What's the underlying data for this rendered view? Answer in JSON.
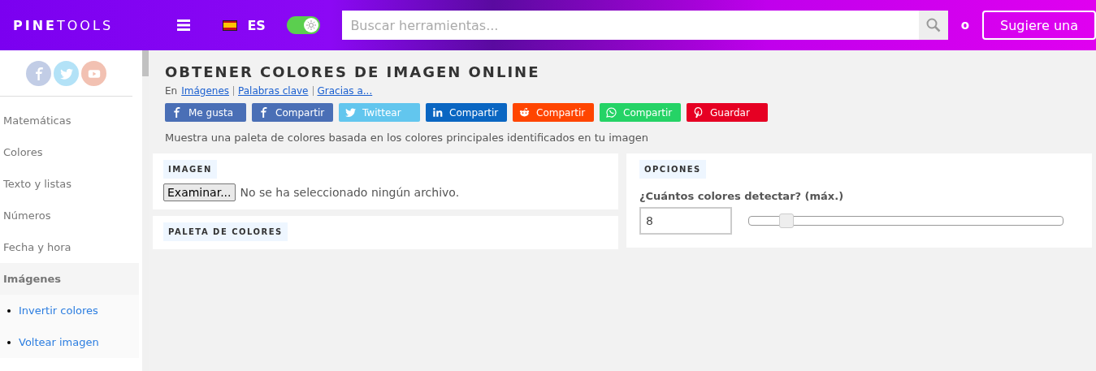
{
  "header": {
    "logo_bold": "PINE",
    "logo_light": "TOOLS",
    "language": "ES",
    "dark_mode_toggle": {
      "on": true
    },
    "search": {
      "placeholder": "Buscar herramientas..."
    },
    "extra": "o",
    "suggest_button": "Sugiere una"
  },
  "sidebar": {
    "social": [
      {
        "kind": "facebook"
      },
      {
        "kind": "twitter"
      },
      {
        "kind": "youtube"
      }
    ],
    "items": [
      {
        "label": "Matemáticas",
        "selected": false
      },
      {
        "label": "Colores",
        "selected": false
      },
      {
        "label": "Texto y listas",
        "selected": false
      },
      {
        "label": "Números",
        "selected": false
      },
      {
        "label": "Fecha y hora",
        "selected": false
      },
      {
        "label": "Imágenes",
        "selected": true,
        "children": [
          {
            "label": "Invertir colores"
          },
          {
            "label": "Voltear imagen"
          }
        ]
      }
    ]
  },
  "page": {
    "title": "OBTENER COLORES DE IMAGEN ONLINE",
    "breadcrumb_prefix": "En",
    "links": [
      "Imágenes",
      "Palabras clave",
      "Gracias a..."
    ],
    "share_buttons": [
      {
        "kind": "facebook",
        "label": "Me gusta"
      },
      {
        "kind": "facebook",
        "label": "Compartir"
      },
      {
        "kind": "twitter",
        "label": "Twittear"
      },
      {
        "kind": "linkedin",
        "label": "Compartir"
      },
      {
        "kind": "reddit",
        "label": "Compartir"
      },
      {
        "kind": "whatsapp",
        "label": "Compartir"
      },
      {
        "kind": "pinterest",
        "label": "Guardar"
      }
    ],
    "description": "Muestra una paleta de colores basada en los colores principales identificados en tu imagen",
    "image_panel": {
      "heading": "IMAGEN",
      "file_button": "Examinar...",
      "file_status": "No se ha seleccionado ningún archivo."
    },
    "palette_panel": {
      "heading": "PALETA DE COLORES"
    },
    "options_panel": {
      "heading": "OPCIONES",
      "label": "¿Cuántos colores detectar? (máx.)",
      "value": "8",
      "slider": {
        "level": 0.1
      }
    }
  }
}
